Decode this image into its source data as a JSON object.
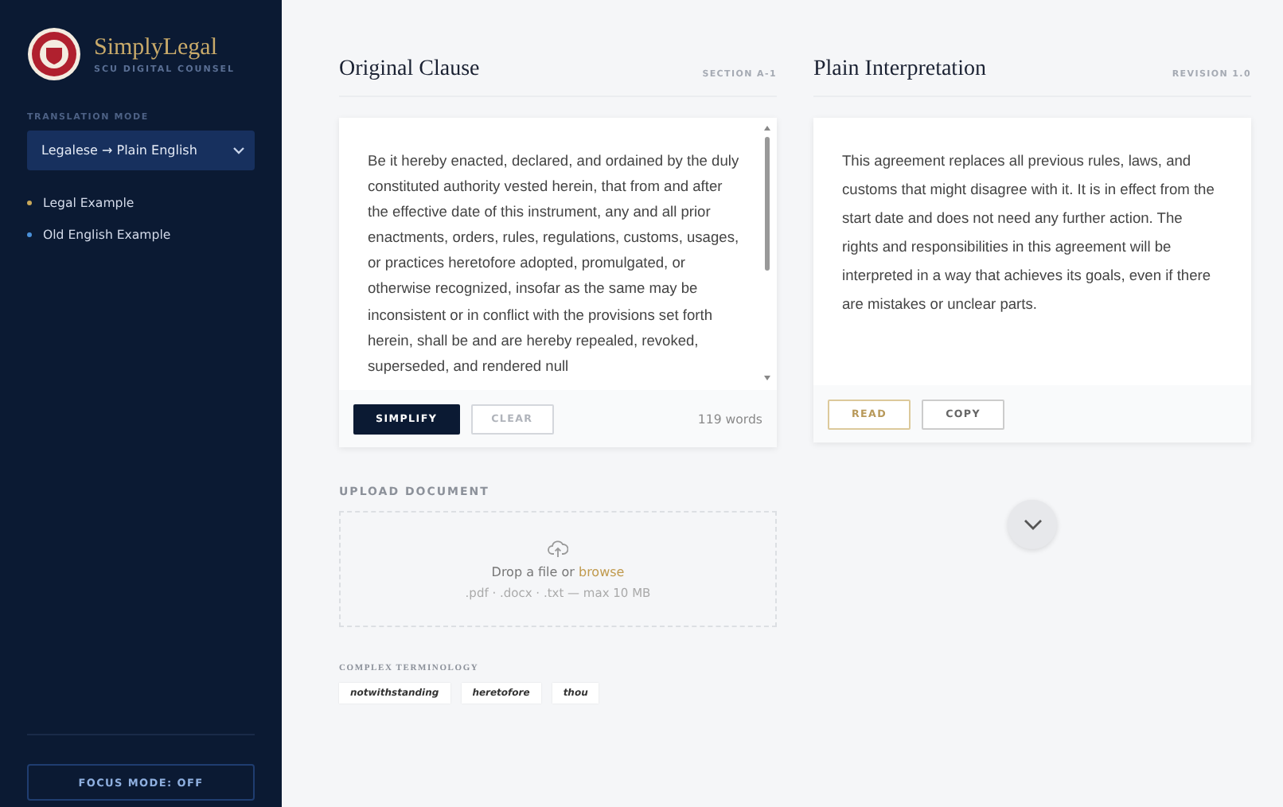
{
  "brand": {
    "name": "SimplyLegal",
    "tagline": "SCU DIGITAL COUNSEL"
  },
  "sidebar": {
    "mode_label": "TRANSLATION MODE",
    "mode_value": "Legalese → Plain English",
    "examples": [
      {
        "label": "Legal Example",
        "color": "#c9a85a"
      },
      {
        "label": "Old English Example",
        "color": "#4a90d9"
      }
    ],
    "focus_button": "FOCUS MODE: OFF"
  },
  "original": {
    "title": "Original Clause",
    "tag": "SECTION A-1",
    "text": "Be it hereby enacted, declared, and ordained by the duly constituted authority vested herein, that from and after the effective date of this instrument, any and all prior enactments, orders, rules, regulations, customs, usages, or practices heretofore adopted, promulgated, or otherwise recognized, insofar as the same may be inconsistent or in conflict with the provisions set forth herein, shall be and are hereby repealed, revoked, superseded, and rendered null",
    "buttons": [
      "SIMPLIFY",
      "CLEAR"
    ],
    "word_count": "119 words"
  },
  "plain": {
    "title": "Plain Interpretation",
    "tag": "REVISION 1.0",
    "text": "This agreement replaces all previous rules, laws, and customs that might disagree with it. It is in effect from the start date and does not need any further action. The rights and responsibilities in this agreement will be interpreted in a way that achieves its goals, even if there are mistakes or unclear parts.",
    "buttons": [
      "READ",
      "COPY"
    ]
  },
  "upload": {
    "label": "UPLOAD DOCUMENT",
    "prompt": "Drop a file or",
    "link": "browse",
    "formats": ".pdf · .docx · .txt — max 10 MB"
  },
  "terminology": {
    "label": "COMPLEX TERMINOLOGY",
    "terms": [
      "notwithstanding",
      "heretofore",
      "thou"
    ]
  }
}
